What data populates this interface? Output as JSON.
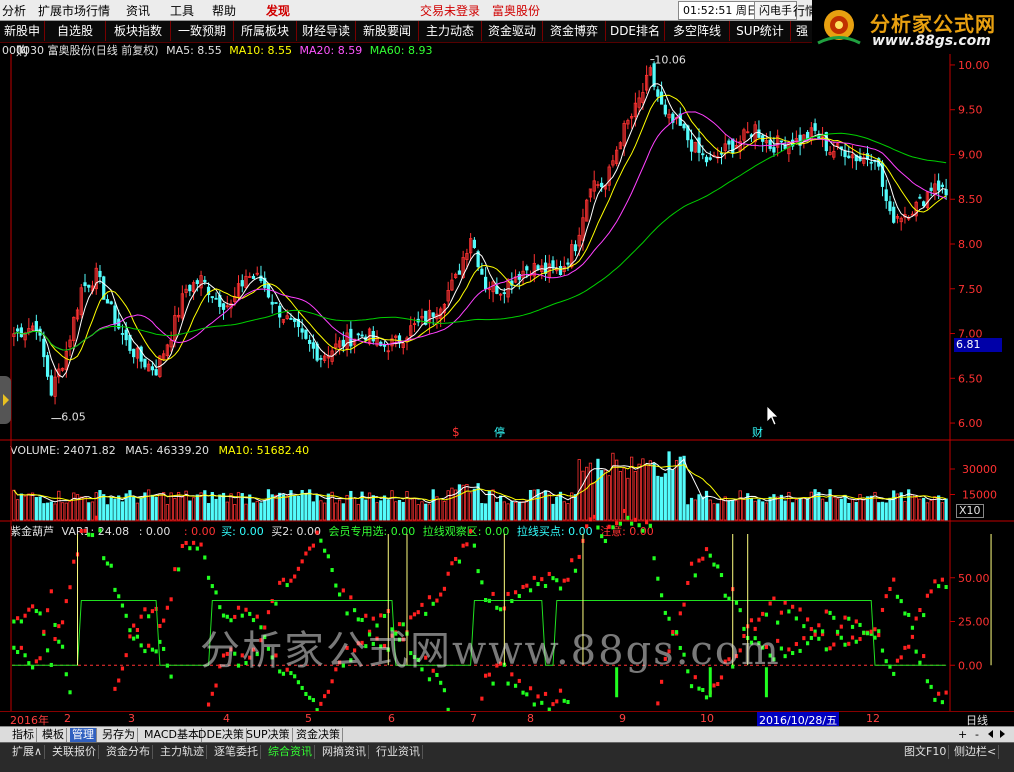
{
  "menu": {
    "items": [
      "分析",
      "扩展市场行情",
      "资讯",
      "工具",
      "帮助"
    ],
    "discover": "发现",
    "login_status": "交易未登录",
    "stock_name": "富奥股份",
    "clock": "01:52:51 周日",
    "flash": "闪电手",
    "market": "行情"
  },
  "toolbar": {
    "items": [
      "新股申购",
      "自选股",
      "板块指数",
      "一致预期",
      "所属板块",
      "财经导读",
      "新股要闻",
      "主力动态",
      "资金驱动",
      "资金博弈",
      "DDE排名",
      "多空阵线",
      "SUP统计",
      "强"
    ]
  },
  "logo": {
    "title": "分析家公式网",
    "url": "www.88gs.com"
  },
  "price_panel": {
    "title": "000030 富奥股份(日线 前复权)",
    "ma5_label": "MA5: 8.55",
    "ma10_label": "MA10: 8.55",
    "ma20_label": "MA20: 8.59",
    "ma60_label": "MA60: 8.93",
    "high_label": "10.06",
    "low_label": "6.05",
    "y_ticks": [
      "10.00",
      "9.50",
      "9.00",
      "8.50",
      "8.00",
      "7.50",
      "7.00",
      "6.50",
      "6.00"
    ],
    "current_price": "6.81",
    "markers": [
      "$",
      "停",
      "财"
    ],
    "colors": {
      "up": "#ff3232",
      "down": "#54fcfc",
      "ma5": "#ffffff",
      "ma10": "#ffff00",
      "ma20": "#ff40ff",
      "ma60": "#00d000",
      "axis": "#c00000"
    }
  },
  "volume_panel": {
    "vol_label": "VOLUME: 24071.82",
    "ma5_label": "MA5: 46339.20",
    "ma10_label": "MA10: 51682.40",
    "y_ticks": [
      "30000",
      "15000"
    ],
    "unit": "X10"
  },
  "indicator_panel": {
    "name": "紫金葫芦",
    "var1": "VAR1: 24.08",
    "v0": ": 0.00",
    "v1": ": 0.00",
    "buy": "买: 0.00",
    "buy2": "买2: 0.00",
    "member": "会员专用选: 0.00",
    "pull_zone": "拉线观察区: 0.00",
    "pull_buy": "拉线买点: 0.00",
    "attention": "注意: 0.00",
    "y_ticks": [
      "50.00",
      "25.00",
      "0.00"
    ]
  },
  "watermark": "分析家公式网www.88gs.com",
  "dates": {
    "year": "2016年",
    "months": [
      "2",
      "3",
      "4",
      "5",
      "6",
      "7",
      "8",
      "9",
      "10",
      "11",
      "12"
    ],
    "selected_date": "2016/10/28/五",
    "period": "日线"
  },
  "tabs_row1": [
    "指标",
    "模板",
    "管理",
    "另存为",
    "MACD基本",
    "DDE决策",
    "SUP决策",
    "资金决策"
  ],
  "tabs_row1_selected": "管理",
  "tabs_row2": [
    "扩展∧",
    "关联报价",
    "资金分布",
    "主力轨迹",
    "逐笔委托",
    "综合资讯",
    "网摘资讯",
    "行业资讯"
  ],
  "status": {
    "f10": "图文F10",
    "sidebar": "侧边栏<"
  },
  "chart_data": {
    "type": "candlestick",
    "title": "000030 富奥股份(日线 前复权)",
    "price_range": [
      5.9,
      10.1
    ],
    "annotations": {
      "high": 10.06,
      "low": 6.05,
      "current_price_tag": 6.81
    },
    "ma_values": {
      "MA5": 8.55,
      "MA10": 8.55,
      "MA20": 8.59,
      "MA60": 8.93
    },
    "close_anchors": [
      [
        0,
        7.0
      ],
      [
        6,
        7.1
      ],
      [
        10,
        6.35
      ],
      [
        14,
        6.8
      ],
      [
        18,
        7.5
      ],
      [
        22,
        7.65
      ],
      [
        26,
        7.25
      ],
      [
        30,
        6.9
      ],
      [
        34,
        6.7
      ],
      [
        38,
        6.6
      ],
      [
        42,
        7.0
      ],
      [
        46,
        7.5
      ],
      [
        50,
        7.6
      ],
      [
        54,
        7.4
      ],
      [
        58,
        7.3
      ],
      [
        62,
        7.65
      ],
      [
        66,
        7.6
      ],
      [
        70,
        7.3
      ],
      [
        74,
        7.1
      ],
      [
        78,
        6.9
      ],
      [
        82,
        6.75
      ],
      [
        86,
        6.85
      ],
      [
        90,
        6.95
      ],
      [
        94,
        7.0
      ],
      [
        98,
        6.85
      ],
      [
        102,
        6.9
      ],
      [
        106,
        7.05
      ],
      [
        110,
        7.15
      ],
      [
        114,
        7.35
      ],
      [
        118,
        7.6
      ],
      [
        122,
        8.1
      ],
      [
        126,
        7.55
      ],
      [
        130,
        7.5
      ],
      [
        134,
        7.65
      ],
      [
        138,
        7.75
      ],
      [
        142,
        7.7
      ],
      [
        146,
        7.7
      ],
      [
        150,
        8.0
      ],
      [
        154,
        8.7
      ],
      [
        158,
        8.65
      ],
      [
        162,
        9.2
      ],
      [
        166,
        9.5
      ],
      [
        170,
        9.9
      ],
      [
        174,
        9.4
      ],
      [
        178,
        9.3
      ],
      [
        182,
        9.05
      ],
      [
        186,
        8.9
      ],
      [
        190,
        9.05
      ],
      [
        194,
        9.15
      ],
      [
        198,
        9.3
      ],
      [
        202,
        9.1
      ],
      [
        206,
        9.15
      ],
      [
        210,
        9.15
      ],
      [
        214,
        9.25
      ],
      [
        218,
        9.05
      ],
      [
        222,
        9.05
      ],
      [
        226,
        8.95
      ],
      [
        230,
        9.0
      ],
      [
        234,
        8.3
      ],
      [
        238,
        8.35
      ],
      [
        242,
        8.45
      ],
      [
        246,
        8.7
      ],
      [
        249,
        8.55
      ]
    ],
    "volume_range": [
      0,
      40000
    ],
    "indicator_range": [
      -25,
      75
    ]
  }
}
